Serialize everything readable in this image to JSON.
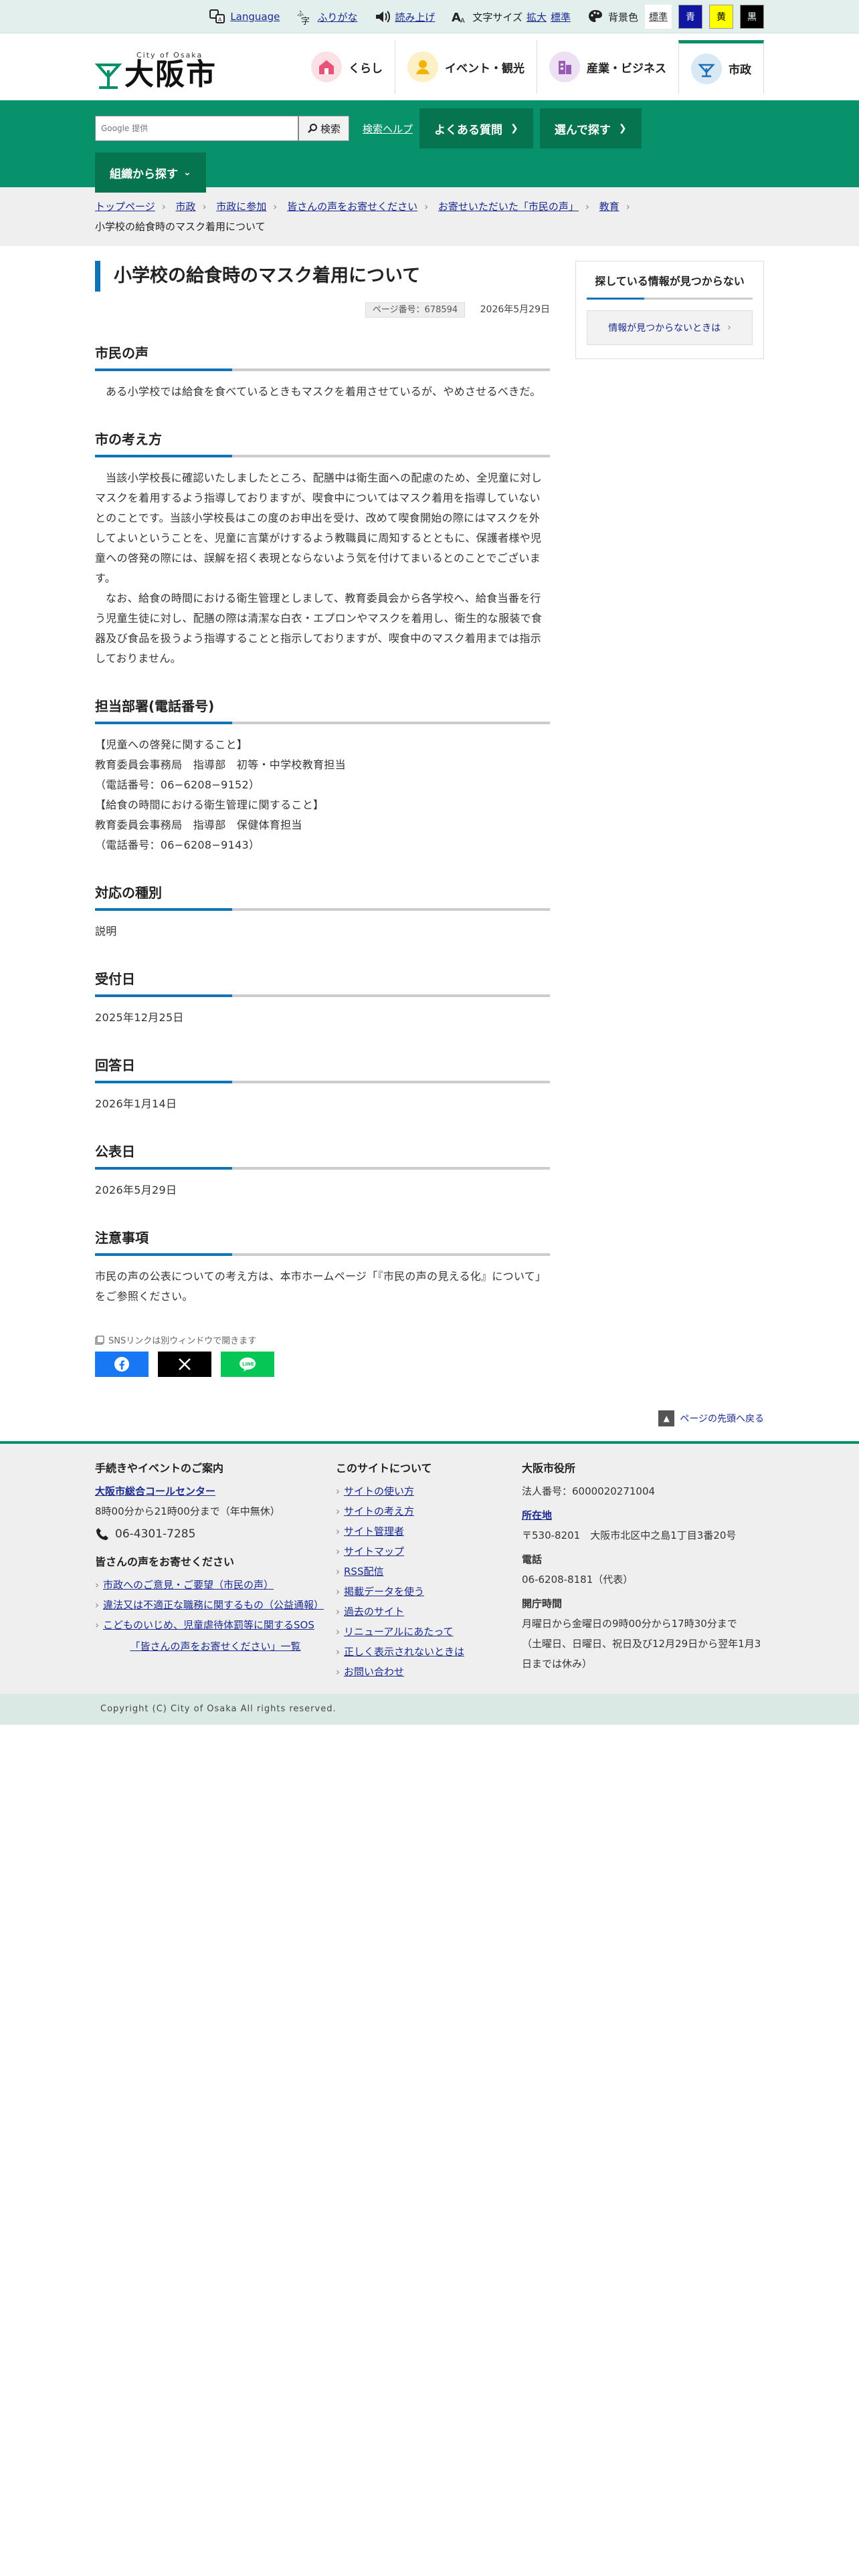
{
  "util": {
    "language": "Language",
    "furigana": "ふりがな",
    "readaloud": "読み上げ",
    "fontsize_label": "文字サイズ",
    "fontsize_large": "拡大",
    "fontsize_std": "標準",
    "bgcolor_label": "背景色",
    "bg_std": "標準",
    "bg_blue": "青",
    "bg_yellow": "黄",
    "bg_black": "黒"
  },
  "logo": {
    "en": "City of Osaka",
    "ja": "大阪市"
  },
  "gnav": [
    {
      "label": "くらし"
    },
    {
      "label": "イベント・観光"
    },
    {
      "label": "産業・ビジネス"
    },
    {
      "label": "市政"
    }
  ],
  "search": {
    "placeholder": "Google 提供",
    "button": "検索",
    "help": "検索ヘルプ"
  },
  "greenbar": {
    "faq": "よくある質問",
    "choose": "選んで探す",
    "org": "組織から探す"
  },
  "breadcrumb": [
    "トップページ",
    "市政",
    "市政に参加",
    "皆さんの声をお寄せください",
    "お寄せいただいた「市民の声」",
    "教育",
    "小学校の給食時のマスク着用について"
  ],
  "page": {
    "title": "小学校の給食時のマスク着用について",
    "page_no": "ページ番号：678594",
    "date": "2026年5月29日"
  },
  "sections": {
    "voice": {
      "heading": "市民の声",
      "body": "ある小学校では給食を食べているときもマスクを着用させているが、やめさせるべきだ。"
    },
    "view": {
      "heading": "市の考え方",
      "body1": "当該小学校長に確認いたしましたところ、配膳中は衛生面への配慮のため、全児童に対しマスクを着用するよう指導しておりますが、喫食中についてはマスク着用を指導していないとのことです。当該小学校長はこの度のお申出を受け、改めて喫食開始の際にはマスクを外してよいということを、児童に言葉がけするよう教職員に周知するとともに、保護者様や児童への啓発の際には、誤解を招く表現とならないよう気を付けてまいるとのことでございます。",
      "body2": "なお、給食の時間における衛生管理としまして、教育委員会から各学校へ、給食当番を行う児童生徒に対し、配膳の際は清潔な白衣・エプロンやマスクを着用し、衛生的な服装で食器及び食品を扱うよう指導することと指示しておりますが、喫食中のマスク着用までは指示しておりません。"
    },
    "dept": {
      "heading": "担当部署(電話番号)",
      "lines": [
        "【児童への啓発に関すること】",
        "教育委員会事務局　指導部　初等・中学校教育担当",
        "（電話番号：06−6208−9152）",
        "【給食の時間における衛生管理に関すること】",
        "教育委員会事務局　指導部　保健体育担当",
        "（電話番号：06−6208−9143）"
      ]
    },
    "kind": {
      "heading": "対応の種別",
      "body": "説明"
    },
    "received": {
      "heading": "受付日",
      "body": "2025年12月25日"
    },
    "answered": {
      "heading": "回答日",
      "body": "2026年1月14日"
    },
    "published": {
      "heading": "公表日",
      "body": "2026年5月29日"
    },
    "notes": {
      "heading": "注意事項",
      "body": "市民の声の公表についての考え方は、本市ホームページ「『市民の声の見える化』について」をご参照ください。"
    }
  },
  "sns": {
    "note": "SNSリンクは別ウィンドウで開きます"
  },
  "aside": {
    "title": "探している情報が見つからない",
    "link": "情報が見つからないときは"
  },
  "pagetop": "ページの先頭へ戻る",
  "footer": {
    "col1": {
      "heading": "手続きやイベントのご案内",
      "callcenter": "大阪市総合コールセンター",
      "hours": "8時00分から21時00分まで（年中無休）",
      "tel": "06-4301-7285",
      "heading2": "皆さんの声をお寄せください",
      "links": [
        "市政へのご意見・ご要望（市民の声）",
        "違法又は不適正な職務に関するもの（公益通報）",
        "こどものいじめ、児童虐待体罰等に関するSOS"
      ],
      "list_link": "「皆さんの声をお寄せください」一覧"
    },
    "col2": {
      "heading": "このサイトについて",
      "links": [
        "サイトの使い方",
        "サイトの考え方",
        "サイト管理者",
        "サイトマップ",
        "RSS配信",
        "掲載データを使う",
        "過去のサイト",
        "リニューアルにあたって",
        "正しく表示されないときは",
        "お問い合わせ"
      ]
    },
    "col3": {
      "heading": "大阪市役所",
      "corpno": "法人番号：6000020271004",
      "addr_label": "所在地",
      "addr": "〒530-8201　大阪市北区中之島1丁目3番20号",
      "tel_label": "電話",
      "tel": "06-6208-8181（代表）",
      "hours_label": "開庁時間",
      "hours1": "月曜日から金曜日の9時00分から17時30分まで",
      "hours2": "（土曜日、日曜日、祝日及び12月29日から翌年1月3日までは休み）"
    }
  },
  "copyright": "Copyright (C) City of Osaka All rights reserved."
}
